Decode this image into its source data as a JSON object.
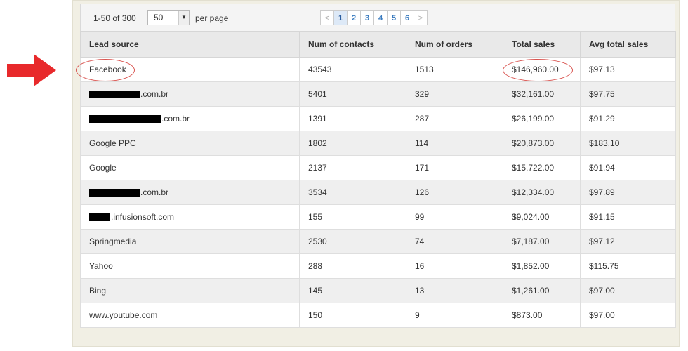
{
  "pager": {
    "range_text": "1-50 of 300",
    "page_size": "50",
    "per_page_label": "per page",
    "prev": "<",
    "next": ">",
    "pages": [
      "1",
      "2",
      "3",
      "4",
      "5",
      "6"
    ],
    "active_page": "1"
  },
  "table": {
    "headers": [
      "Lead source",
      "Num of contacts",
      "Num of orders",
      "Total sales",
      "Avg total sales"
    ],
    "rows": [
      {
        "source": "Facebook",
        "redact_w": 0,
        "contacts": "43543",
        "orders": "1513",
        "total": "$146,960.00",
        "avg": "$97.13"
      },
      {
        "source": ".com.br",
        "redact_w": 72,
        "contacts": "5401",
        "orders": "329",
        "total": "$32,161.00",
        "avg": "$97.75"
      },
      {
        "source": ".com.br",
        "redact_w": 102,
        "contacts": "1391",
        "orders": "287",
        "total": "$26,199.00",
        "avg": "$91.29"
      },
      {
        "source": "Google PPC",
        "redact_w": 0,
        "contacts": "1802",
        "orders": "114",
        "total": "$20,873.00",
        "avg": "$183.10"
      },
      {
        "source": "Google",
        "redact_w": 0,
        "contacts": "2137",
        "orders": "171",
        "total": "$15,722.00",
        "avg": "$91.94"
      },
      {
        "source": ".com.br",
        "redact_w": 72,
        "contacts": "3534",
        "orders": "126",
        "total": "$12,334.00",
        "avg": "$97.89"
      },
      {
        "source": ".infusionsoft.com",
        "redact_w": 30,
        "contacts": "155",
        "orders": "99",
        "total": "$9,024.00",
        "avg": "$91.15"
      },
      {
        "source": "Springmedia",
        "redact_w": 0,
        "contacts": "2530",
        "orders": "74",
        "total": "$7,187.00",
        "avg": "$97.12"
      },
      {
        "source": "Yahoo",
        "redact_w": 0,
        "contacts": "288",
        "orders": "16",
        "total": "$1,852.00",
        "avg": "$115.75"
      },
      {
        "source": "Bing",
        "redact_w": 0,
        "contacts": "145",
        "orders": "13",
        "total": "$1,261.00",
        "avg": "$97.00"
      },
      {
        "source": "www.youtube.com",
        "redact_w": 0,
        "contacts": "150",
        "orders": "9",
        "total": "$873.00",
        "avg": "$97.00"
      }
    ]
  },
  "annotations": {
    "arrow_color": "#e8292b",
    "circle_color": "#d9534f",
    "circled_cells": [
      "Facebook",
      "$146,960.00"
    ]
  }
}
